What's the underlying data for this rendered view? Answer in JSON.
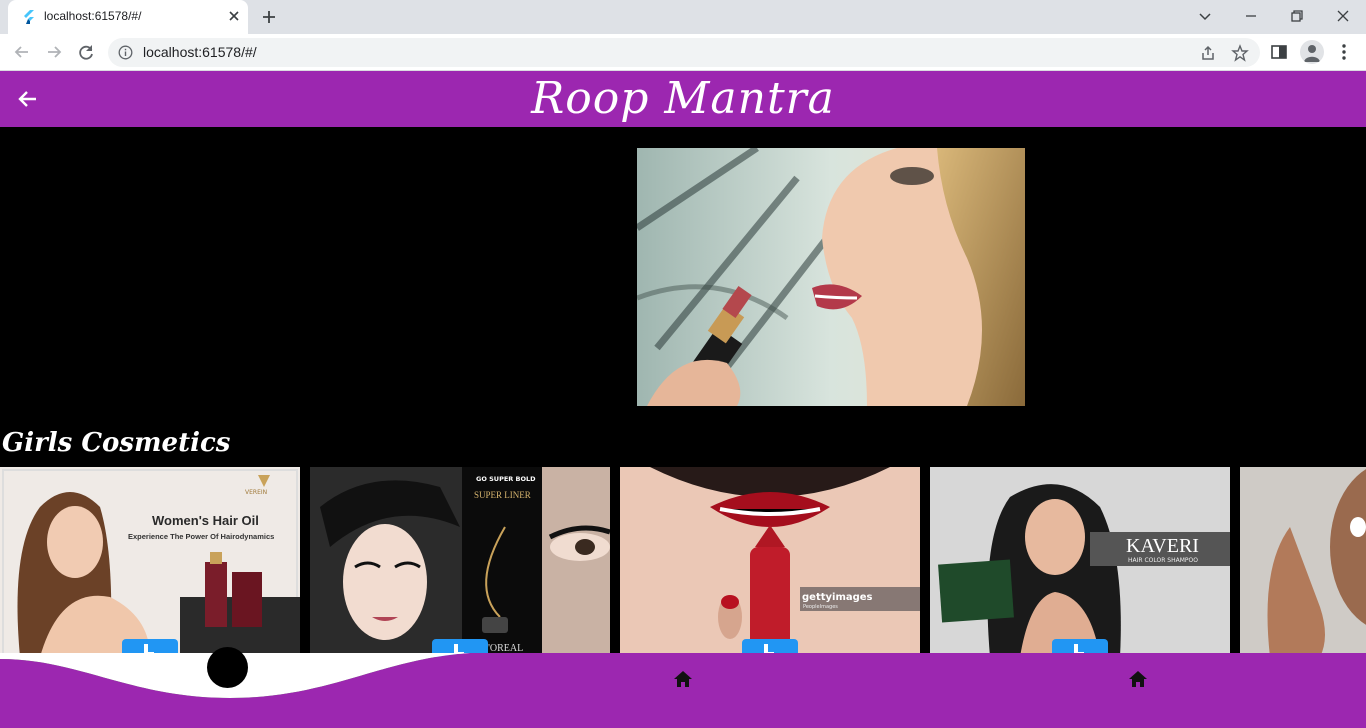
{
  "browser": {
    "tab_title": "localhost:61578/#/",
    "url": "localhost:61578/#/"
  },
  "app": {
    "title": "Roop  Mantra",
    "accent_color": "#9c27b0",
    "section_title": "Girls Cosmetics"
  },
  "cards": [
    {
      "name": "hair-oil-card",
      "heading": "Women's Hair Oil",
      "sub": "Experience The Power Of Hairodynamics",
      "brand": "VEREIN"
    },
    {
      "name": "eyeliner-card",
      "tag": "GO SUPER BOLD",
      "product": "SUPER LINER",
      "brand": "L'OREAL"
    },
    {
      "name": "lipstick-card",
      "watermark": "gettyimages",
      "credit": "PeopleImages"
    },
    {
      "name": "shampoo-card",
      "brand": "KAVERI",
      "sub": "HAIR COLOR SHAMPOO"
    },
    {
      "name": "skincare-card"
    }
  ],
  "icons": {
    "back": "arrow-back-icon",
    "home": "home-icon",
    "open": "open-in-icon"
  }
}
